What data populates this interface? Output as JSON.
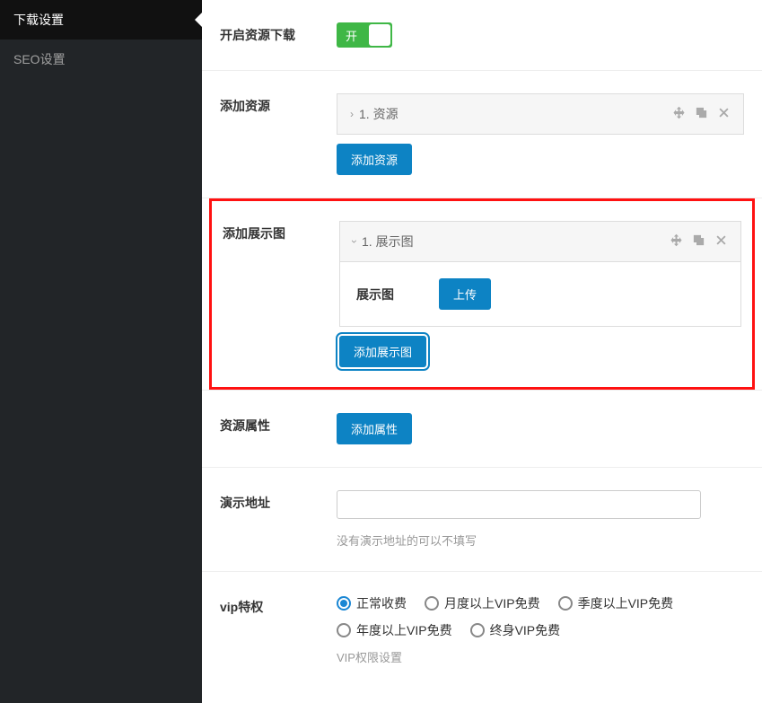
{
  "sidebar": {
    "items": [
      {
        "label": "下载设置",
        "active": true
      },
      {
        "label": "SEO设置",
        "active": false
      }
    ]
  },
  "sections": {
    "download_toggle": {
      "label": "开启资源下载",
      "toggle_text": "开"
    },
    "add_resource": {
      "label": "添加资源",
      "panel_title": "1. 资源",
      "add_btn": "添加资源"
    },
    "add_display": {
      "label": "添加展示图",
      "panel_title": "1. 展示图",
      "body_label": "展示图",
      "upload_btn": "上传",
      "add_btn": "添加展示图"
    },
    "resource_attr": {
      "label": "资源属性",
      "add_btn": "添加属性"
    },
    "demo_url": {
      "label": "演示地址",
      "hint": "没有演示地址的可以不填写"
    },
    "vip": {
      "label": "vip特权",
      "options": [
        "正常收费",
        "月度以上VIP免费",
        "季度以上VIP免费",
        "年度以上VIP免费",
        "终身VIP免费"
      ],
      "selected_index": 0,
      "desc": "VIP权限设置"
    }
  }
}
